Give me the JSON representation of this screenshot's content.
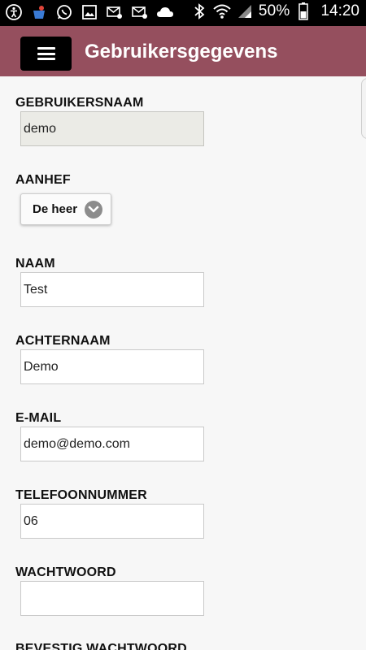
{
  "status_bar": {
    "battery": "50%",
    "time": "14:20",
    "icons": [
      "accessibility-icon",
      "app-notification-icon",
      "whatsapp-icon",
      "image-icon",
      "email-icon",
      "email-icon",
      "cloud-icon",
      "bluetooth-icon",
      "wifi-icon",
      "signal-icon",
      "battery-icon"
    ]
  },
  "app_bar": {
    "title": "Gebruikersgegevens",
    "menu_icon": "hamburger-menu-icon"
  },
  "form": {
    "username": {
      "label": "GEBRUIKERSNAAM",
      "value": "demo"
    },
    "salutation": {
      "label": "AANHEF",
      "value": "De heer"
    },
    "first_name": {
      "label": "NAAM",
      "value": "Test"
    },
    "last_name": {
      "label": "ACHTERNAAM",
      "value": "Demo"
    },
    "email": {
      "label": "E-MAIL",
      "value": "demo@demo.com"
    },
    "phone": {
      "label": "TELEFOONNUMMER",
      "value": "06"
    },
    "password": {
      "label": "WACHTWOORD",
      "value": ""
    },
    "confirm_password": {
      "label": "BEVESTIG WACHTWOORD"
    }
  },
  "colors": {
    "app_bar": "#954f5e",
    "background": "#f7f7f7",
    "readonly_field": "#ebebe6"
  }
}
